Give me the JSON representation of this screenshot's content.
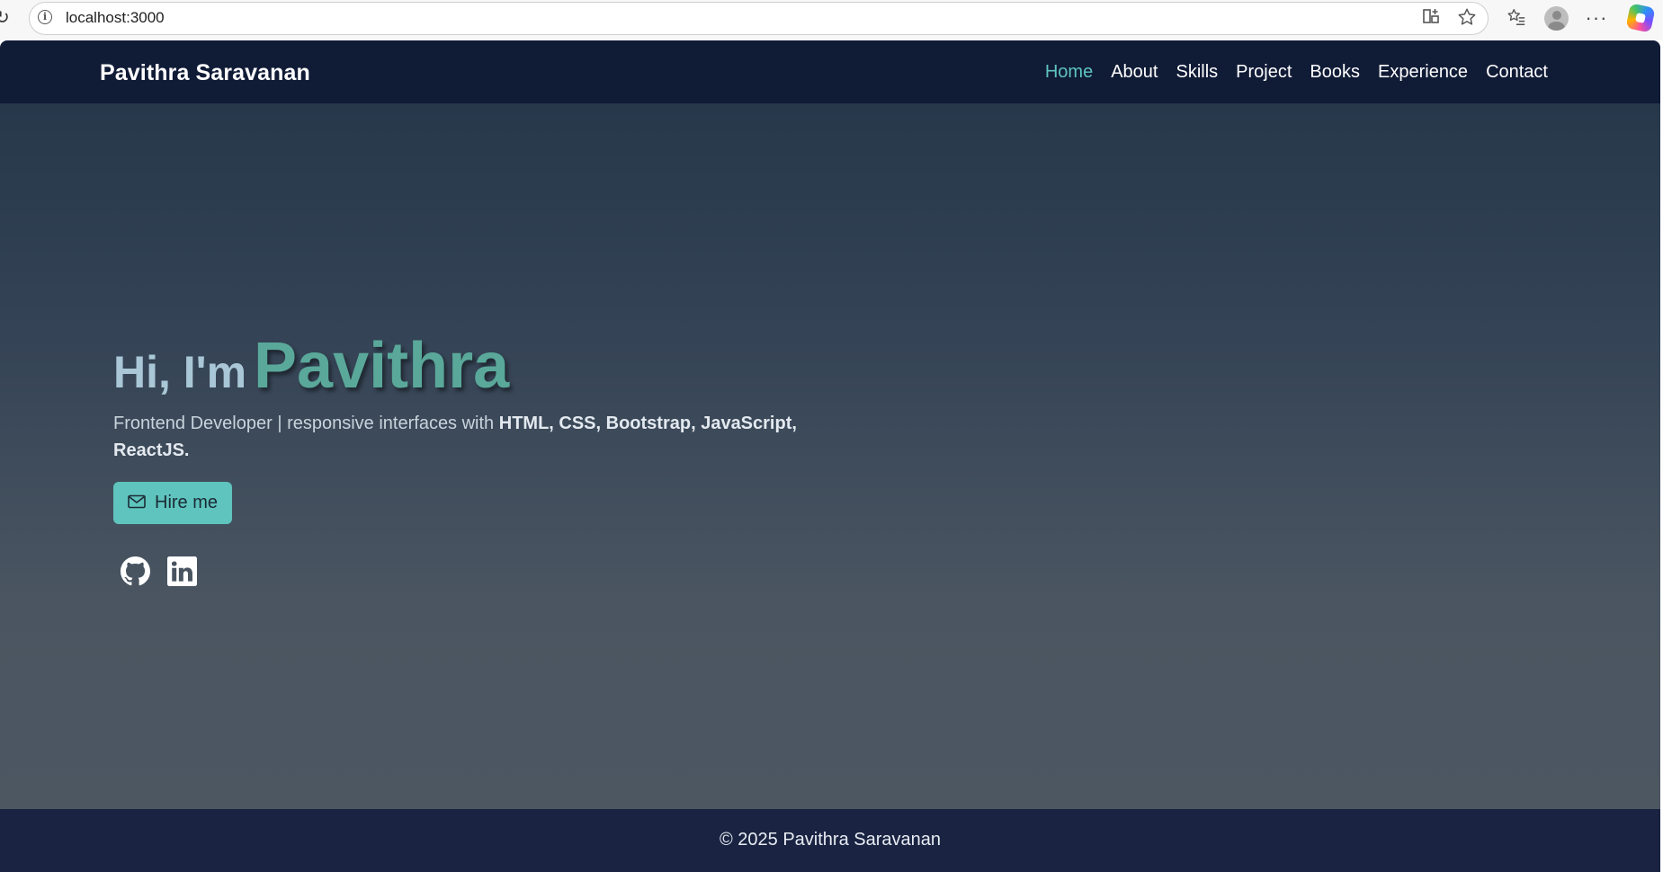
{
  "browser": {
    "url": "localhost:3000",
    "icons": [
      "reload-icon",
      "info-icon",
      "app-available-icon",
      "favorite-star-icon",
      "favorites-list-icon",
      "profile-avatar",
      "more-menu-icon",
      "copilot-icon"
    ]
  },
  "navbar": {
    "brand": "Pavithra Saravanan",
    "links": [
      {
        "label": "Home",
        "active": true
      },
      {
        "label": "About"
      },
      {
        "label": "Skills"
      },
      {
        "label": "Project"
      },
      {
        "label": "Books"
      },
      {
        "label": "Experience"
      },
      {
        "label": "Contact"
      }
    ]
  },
  "hero": {
    "greeting": "Hi, I'm",
    "name": "Pavithra",
    "subtitle_prefix": "Frontend Developer | responsive interfaces with ",
    "subtitle_skills": "HTML, CSS, Bootstrap, JavaScript, ReactJS.",
    "hire_label": "Hire me",
    "social_icons": [
      "github-icon",
      "linkedin-icon"
    ]
  },
  "footer": {
    "text": "© 2025 Pavithra Saravanan"
  },
  "colors": {
    "navbar_bg": "#101b36",
    "accent": "#5ec4bd",
    "name_color": "#5aa89a",
    "footer_bg": "#1a2442"
  }
}
